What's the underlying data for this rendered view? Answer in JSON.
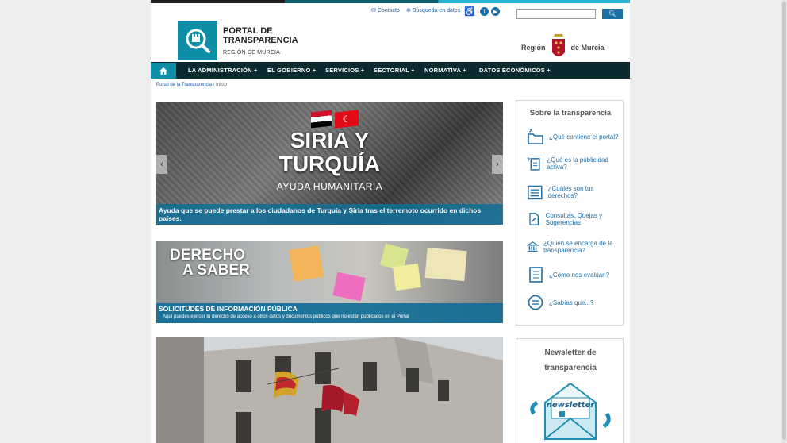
{
  "util": {
    "contact": "Contacto",
    "search_data": "Búsqueda en datos",
    "search_placeholder": ""
  },
  "header": {
    "title": "PORTAL DE TRANSPARENCIA",
    "subtitle": "REGIÓN DE MURCIA",
    "region_left": "Región",
    "region_right": "de Murcia"
  },
  "nav": {
    "items": [
      "LA ADMINISTRACIÓN +",
      "EL GOBIERNO +",
      "SERVICIOS +",
      "SECTORIAL +",
      "NORMATIVA +",
      "DATOS ECONÓMICOS +"
    ]
  },
  "breadcrumb": {
    "root": "Portal de la Transparencia",
    "sep": "/",
    "current": "Inicio"
  },
  "banner1": {
    "heading_line1": "SIRIA Y",
    "heading_line2": "TURQUÍA",
    "subheading": "AYUDA HUMANITARIA",
    "caption": "Ayuda que se puede prestar a los ciudadanos de Turquía y Siria tras el terremoto ocurrido en dichos países."
  },
  "banner2": {
    "heading_line1": "DERECHO",
    "heading_line2": "A SABER",
    "caption_title": "SOLICITUDES DE INFORMACIÓN PÚBLICA",
    "caption_desc": "Aquí puedes ejercer tu derecho de acceso a otros datos y documentos públicos que no están publicados en el Portal"
  },
  "sidebar": {
    "title": "Sobre la transparencia",
    "items": [
      "¿Qué contiene el portal?",
      "¿Qué es la publicidad activa?",
      "¿Cuáles son tus derechos?",
      "Consultas, Quejas y Sugerencias",
      "¿Quién se encarga de la transparencia?",
      "¿Cómo nos evalúan?",
      "¿Sabías que...?"
    ]
  },
  "newsletter": {
    "title_line1": "Newsletter de",
    "title_line2": "transparencia",
    "graphic_text": "newsletter"
  },
  "colors": {
    "brand": "#0f8ea8",
    "nav_bg": "#0a2a2f",
    "link": "#1f6fa6",
    "caption_bg": "#0f6e96"
  }
}
